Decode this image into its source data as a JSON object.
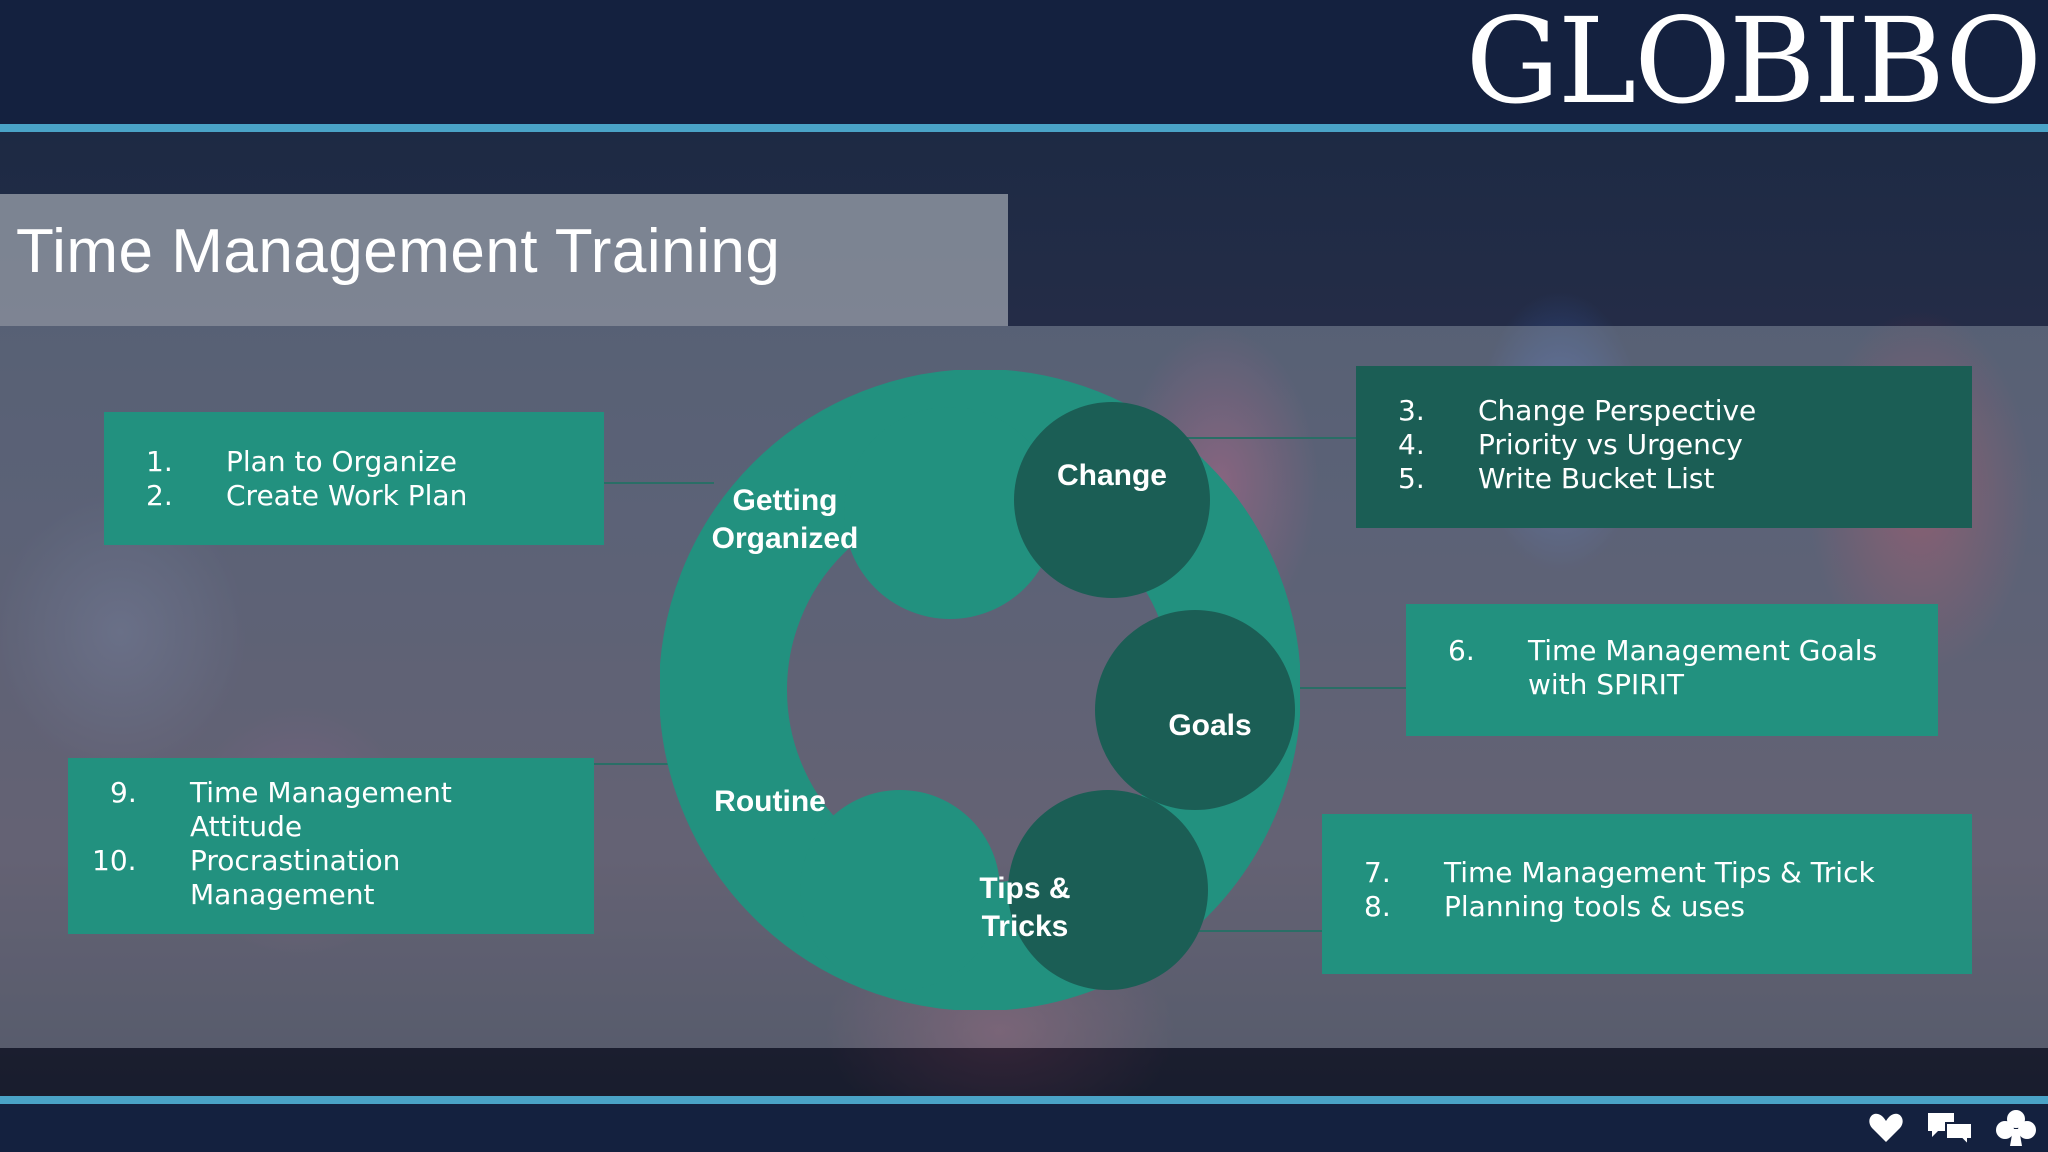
{
  "header": {
    "logo": "GLOBIBO"
  },
  "slide": {
    "title": "Time Management Training",
    "cycle": {
      "stages": [
        {
          "label": "Getting\nOrganized"
        },
        {
          "label": "Change"
        },
        {
          "label": "Goals"
        },
        {
          "label": "Tips &\nTricks"
        },
        {
          "label": "Routine"
        }
      ]
    },
    "boxes": {
      "getting_organized": {
        "items": [
          {
            "num": "1.",
            "text": "Plan to Organize"
          },
          {
            "num": "2.",
            "text": "Create Work Plan"
          }
        ]
      },
      "change": {
        "items": [
          {
            "num": "3.",
            "text": "Change Perspective"
          },
          {
            "num": "4.",
            "text": "Priority vs Urgency"
          },
          {
            "num": "5.",
            "text": "Write Bucket List"
          }
        ]
      },
      "goals": {
        "items": [
          {
            "num": "6.",
            "text": "Time Management Goals\nwith SPIRIT"
          }
        ]
      },
      "tips": {
        "items": [
          {
            "num": "7.",
            "text": "Time Management Tips & Trick"
          },
          {
            "num": "8.",
            "text": "Planning tools & uses"
          }
        ]
      },
      "routine": {
        "items": [
          {
            "num": "9.",
            "text": "Time Management\nAttitude"
          },
          {
            "num": "10.",
            "text": "Procrastination\nManagement"
          }
        ]
      }
    }
  },
  "footer": {
    "icons": [
      "heart-icon",
      "chat-bubbles-icon",
      "club-icon"
    ]
  }
}
